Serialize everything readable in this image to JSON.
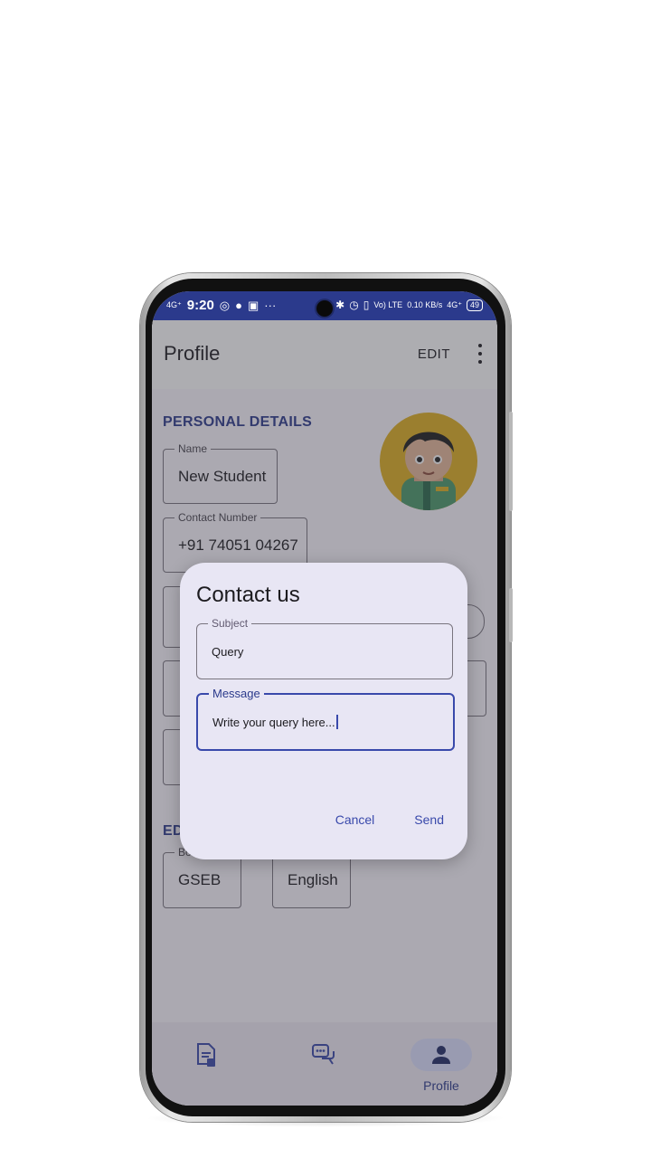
{
  "status_bar": {
    "signal": "4G⁺",
    "time": "9:20",
    "more": "···",
    "volte": "Vo) LTE",
    "speed": "0.10 KB/s",
    "network": "4G⁺",
    "battery": "49"
  },
  "appbar": {
    "title": "Profile",
    "edit_label": "EDIT"
  },
  "personal": {
    "section_title": "PERSONAL DETAILS",
    "name_label": "Name",
    "name_value": "New Student",
    "contact_label": "Contact Number",
    "contact_value": "+91 74051 04267"
  },
  "education": {
    "section_title": "ED",
    "board_label": "Bo",
    "board_value": "GSEB",
    "medium_value": "English"
  },
  "dialog": {
    "title": "Contact us",
    "subject_label": "Subject",
    "subject_value": "Query",
    "message_label": "Message",
    "message_value": "Write your query here...",
    "cancel_label": "Cancel",
    "send_label": "Send"
  },
  "bottom_nav": {
    "items": [
      {
        "icon": "document-edit-icon",
        "label": ""
      },
      {
        "icon": "chat-bubbles-icon",
        "label": ""
      },
      {
        "icon": "person-icon",
        "label": "Profile"
      }
    ]
  }
}
